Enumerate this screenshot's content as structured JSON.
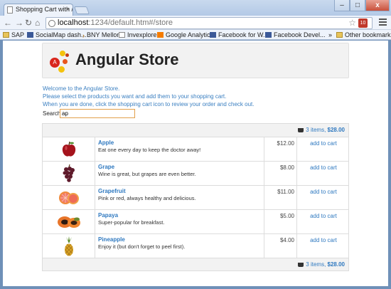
{
  "browser": {
    "tab_title": "Shopping Cart with /",
    "tab_close": "×",
    "url_host": "localhost",
    "url_path": ":1234/default.htm#/store",
    "window_buttons": {
      "minimize": "–",
      "maximize": "□",
      "close": "x"
    },
    "bookmarks": [
      "SAP",
      "SocialMap dash...",
      "BNY Mellon",
      "Invexplorer",
      "Google Analytics",
      "Facebook for W...",
      "Facebook Devel..."
    ],
    "bookmarks_more": "»",
    "other_bookmarks": "Other bookmarks"
  },
  "store": {
    "title": "Angular Store",
    "logo_letter": "A",
    "intro_lines": [
      "Welcome to the Angular Store.",
      "Please select the products you want and add them to your shopping cart.",
      "When you are done, click the shopping cart icon to review your order and check out."
    ],
    "search_label": "Search:",
    "search_value": "ap"
  },
  "cart": {
    "summary_count": "3 items,",
    "summary_total": "$28.00"
  },
  "products": [
    {
      "name": "Apple",
      "description": "Eat one every day to keep the doctor away!",
      "price": "$12.00",
      "action": "add to cart",
      "icon": "apple-icon"
    },
    {
      "name": "Grape",
      "description": "Wine is great, but grapes are even better.",
      "price": "$8.00",
      "action": "add to cart",
      "icon": "grape-icon"
    },
    {
      "name": "Grapefruit",
      "description": "Pink or red, always healthy and delicious.",
      "price": "$11.00",
      "action": "add to cart",
      "icon": "grapefruit-icon"
    },
    {
      "name": "Papaya",
      "description": "Super-popular for breakfast.",
      "price": "$5.00",
      "action": "add to cart",
      "icon": "papaya-icon"
    },
    {
      "name": "Pineapple",
      "description": "Enjoy it (but don't forget to peel first).",
      "price": "$4.00",
      "action": "add to cart",
      "icon": "pineapple-icon"
    }
  ],
  "colors": {
    "link": "#2f79c0",
    "panel": "#f2f2f2",
    "search_border": "#e2a04b"
  }
}
